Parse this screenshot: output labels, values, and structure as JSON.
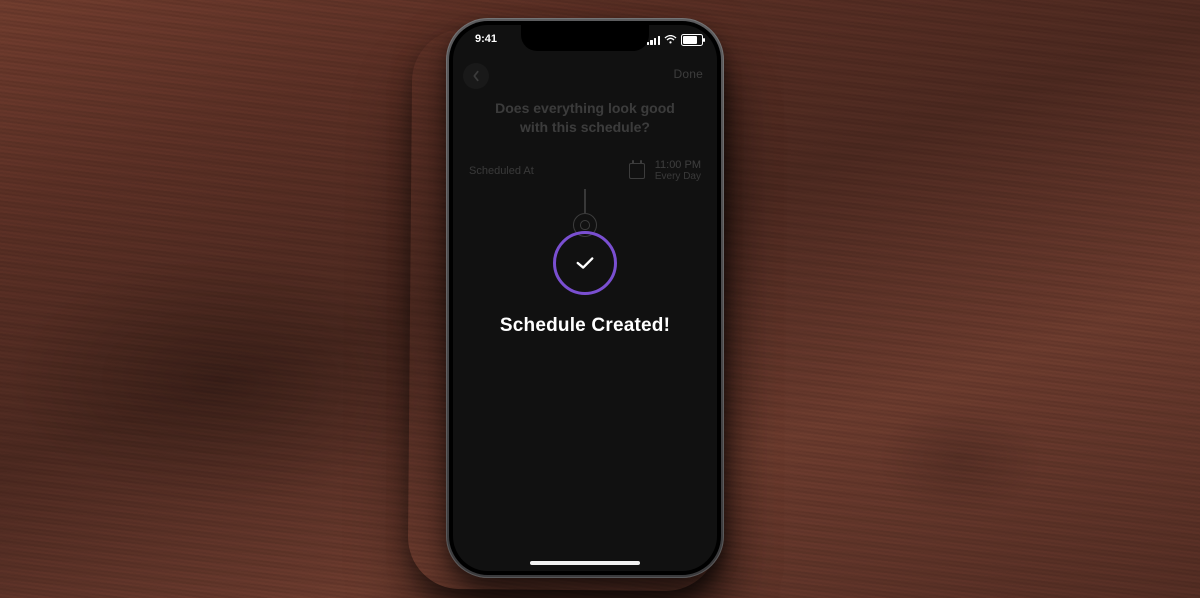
{
  "status_bar": {
    "time": "9:41"
  },
  "nav": {
    "done_label": "Done"
  },
  "page": {
    "title_question": "Does everything look good with this schedule?",
    "scheduled_label": "Scheduled At",
    "time": "11:00 PM",
    "recurrence": "Every Day"
  },
  "overlay": {
    "message": "Schedule Created!"
  },
  "colors": {
    "accent": "#7a4fd1"
  }
}
